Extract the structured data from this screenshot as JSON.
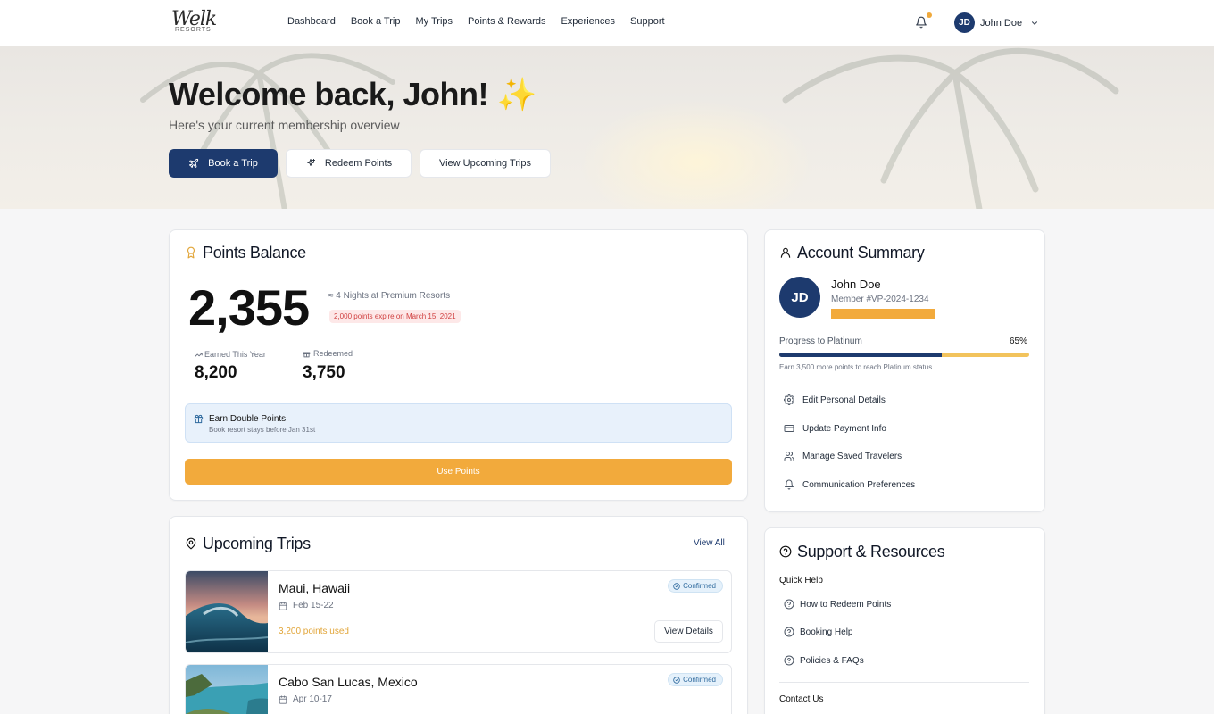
{
  "brand": {
    "logo_script": "Welk",
    "logo_sub": "RESORTS"
  },
  "nav": {
    "links": [
      "Dashboard",
      "Book a Trip",
      "My Trips",
      "Points & Rewards",
      "Experiences",
      "Support"
    ],
    "user_initials": "JD",
    "user_name": "John Doe",
    "notification_dot_color": "#f0a93b"
  },
  "hero": {
    "title": "Welcome back, John! ✨",
    "subtitle": "Here's your current membership overview",
    "buttons": {
      "book": "Book a Trip",
      "redeem": "Redeem Points",
      "view_trips": "View Upcoming Trips"
    }
  },
  "points": {
    "title": "Points Balance",
    "balance": "2,355",
    "nights": "≈ 4 Nights at Premium Resorts",
    "expire_notice": "2,000 points expire on March 15, 2021",
    "earned_label": "Earned This Year",
    "earned_value": "8,200",
    "redeemed_label": "Redeemed",
    "redeemed_value": "3,750",
    "promo_title": "Earn Double Points!",
    "promo_sub": "Book resort stays before Jan 31st",
    "use_button": "Use Points"
  },
  "trips": {
    "title": "Upcoming Trips",
    "view_all": "View All",
    "items": [
      {
        "name": "Maui, Hawaii",
        "dates": "Feb 15-22",
        "points": "3,200 points used",
        "status": "Confirmed",
        "action": "View Details"
      },
      {
        "name": "Cabo San Lucas, Mexico",
        "dates": "Apr 10-17",
        "status": "Confirmed"
      }
    ]
  },
  "account": {
    "title": "Account Summary",
    "initials": "JD",
    "name": "John Doe",
    "member_id": "Member #VP-2024-1234",
    "progress_label": "Progress to Platinum",
    "progress_text": "65%",
    "progress_value": 0.65,
    "progress_note": "Earn 3,500 more points to reach Platinum status",
    "links": [
      "Edit Personal Details",
      "Update Payment Info",
      "Manage Saved Travelers",
      "Communication Preferences"
    ]
  },
  "support": {
    "title": "Support & Resources",
    "quick_help": "Quick Help",
    "links": [
      "How to Redeem Points",
      "Booking Help",
      "Policies & FAQs"
    ],
    "contact_us": "Contact Us"
  },
  "colors": {
    "primary": "#1d3a6e",
    "accent": "#f2aa3c",
    "danger_bg": "#fde8e8",
    "info_bg": "#e8f1fb"
  }
}
